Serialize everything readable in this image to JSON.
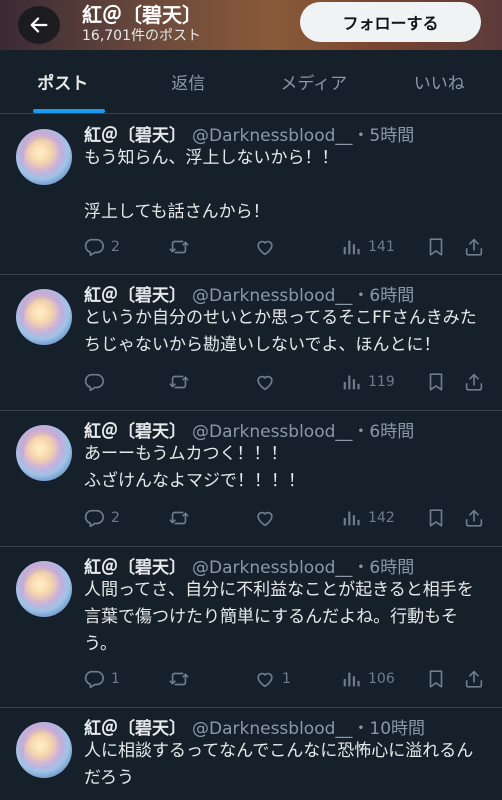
{
  "header": {
    "name": "紅＠〔碧天〕",
    "post_count": "16,701件のポスト",
    "follow_label": "フォローする"
  },
  "tabs": [
    {
      "label": "ポスト",
      "active": true
    },
    {
      "label": "返信",
      "active": false
    },
    {
      "label": "メディア",
      "active": false
    },
    {
      "label": "いいね",
      "active": false
    }
  ],
  "tweets": [
    {
      "name": "紅＠〔碧天〕",
      "handle": "@Darknessblood__・5時間",
      "text": "もう知らん、浮上しないから！！\n\n浮上しても話さんから！",
      "replies": "2",
      "likes": "",
      "views": "141"
    },
    {
      "name": "紅＠〔碧天〕",
      "handle": "@Darknessblood__・6時間",
      "text": "というか自分のせいとか思ってるそこFFさんきみたちじゃないから勘違いしないでよ、ほんとに！",
      "replies": "",
      "likes": "",
      "views": "119"
    },
    {
      "name": "紅＠〔碧天〕",
      "handle": "@Darknessblood__・6時間",
      "text": "あーーもうムカつく！！！\nふざけんなよマジで！！！！",
      "replies": "2",
      "likes": "",
      "views": "142"
    },
    {
      "name": "紅＠〔碧天〕",
      "handle": "@Darknessblood__・6時間",
      "text": "人間ってさ、自分に不利益なことが起きると相手を言葉で傷つけたり簡単にするんだよね。行動もそう。",
      "replies": "1",
      "likes": "1",
      "views": "106"
    },
    {
      "name": "紅＠〔碧天〕",
      "handle": "@Darknessblood__・10時間",
      "text": "人に相談するってなんでこんなに恐怖心に溢れるんだろう",
      "replies": "",
      "likes": "",
      "views": ""
    }
  ],
  "icons": {
    "back": "arrow-left-icon",
    "reply": "reply-icon",
    "retweet": "retweet-icon",
    "like": "heart-icon",
    "views": "views-icon",
    "bookmark": "bookmark-icon",
    "share": "share-icon"
  },
  "colors": {
    "background": "#15202b",
    "accent": "#1d9bf0",
    "muted": "#8b98a5"
  }
}
